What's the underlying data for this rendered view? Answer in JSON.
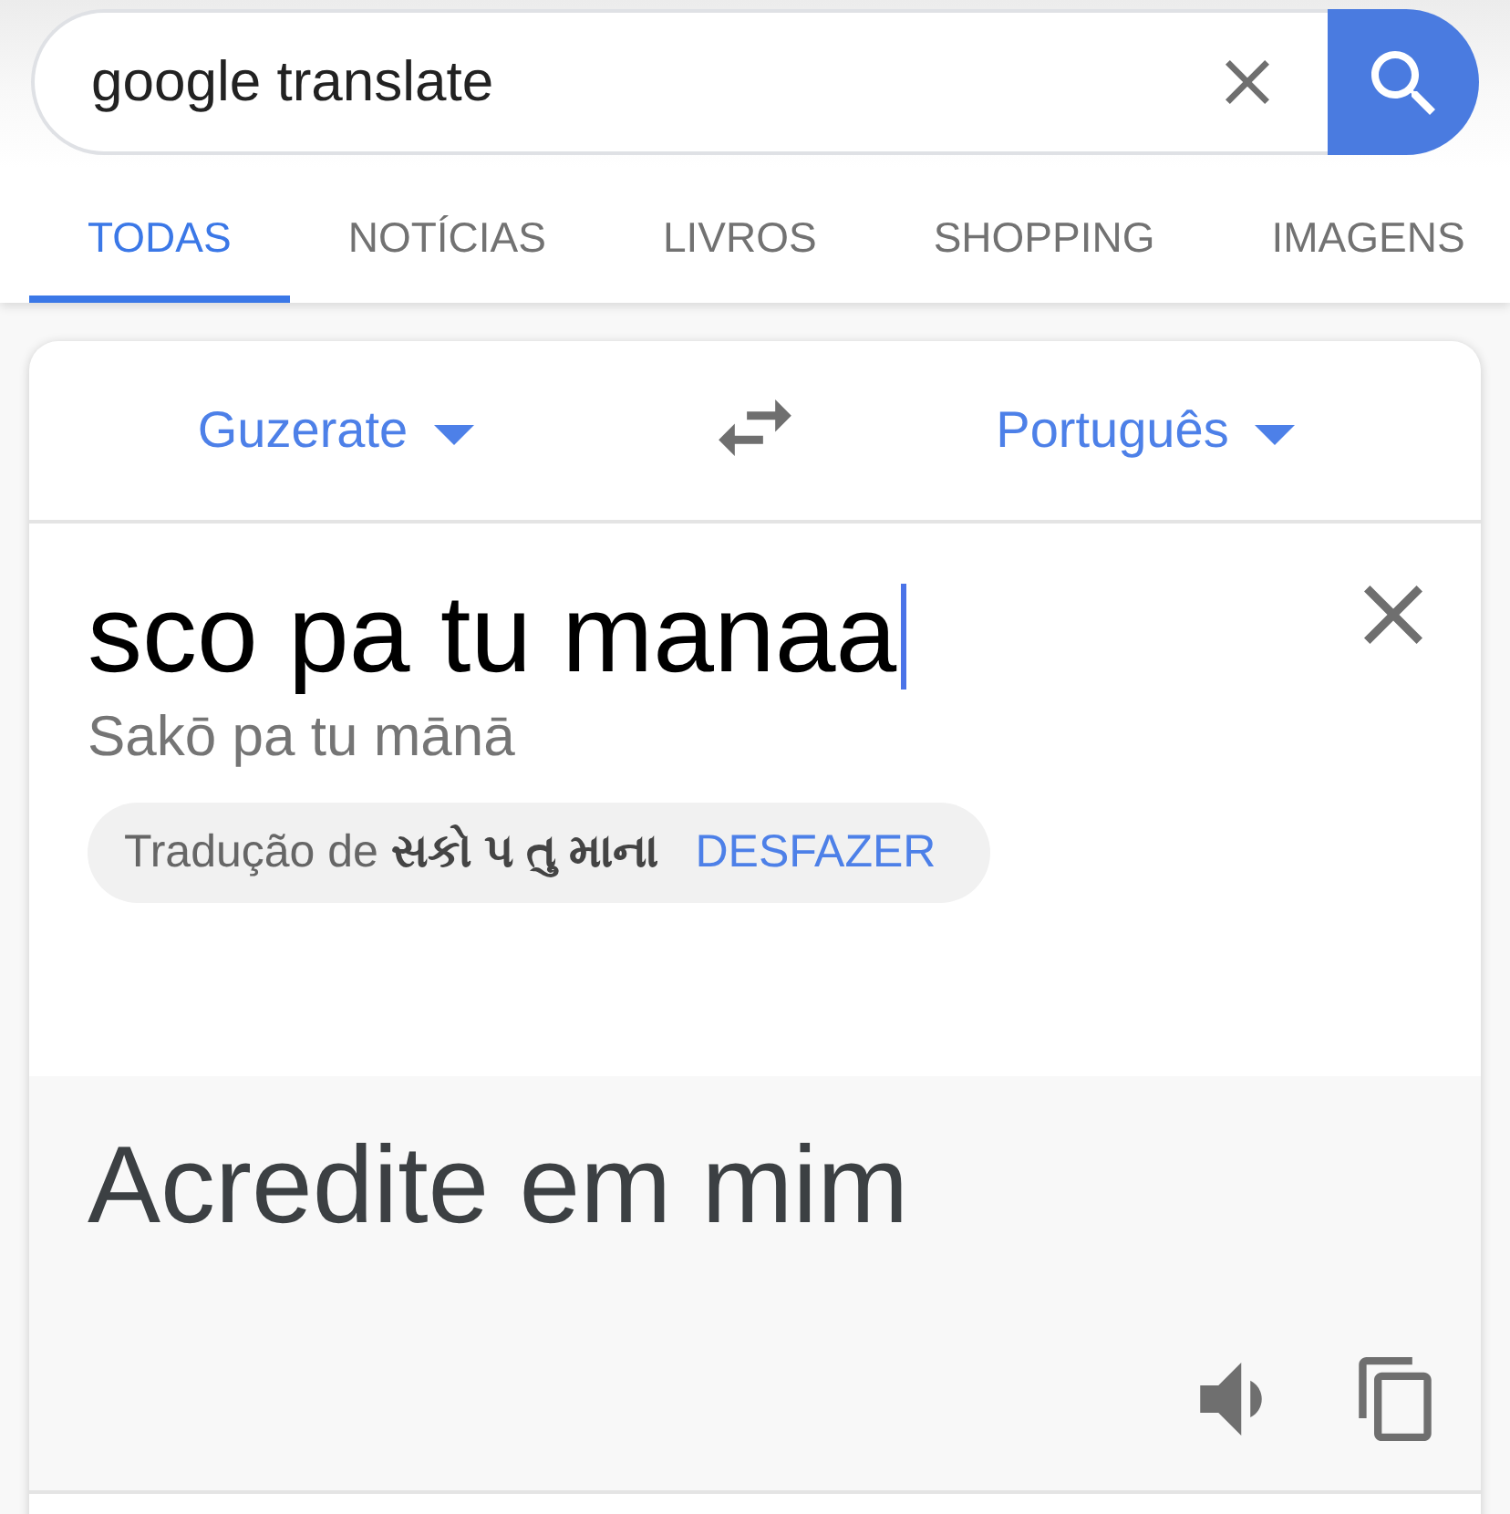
{
  "search": {
    "value": "google translate"
  },
  "tabs": [
    {
      "label": "TODAS",
      "selected": true
    },
    {
      "label": "NOTÍCIAS",
      "selected": false
    },
    {
      "label": "LIVROS",
      "selected": false
    },
    {
      "label": "SHOPPING",
      "selected": false
    },
    {
      "label": "IMAGENS",
      "selected": false
    }
  ],
  "translator": {
    "source_language": "Guzerate",
    "target_language": "Português",
    "input": {
      "value": "sco pa tu manaa",
      "focused": true,
      "transliteration": "Sakō pa tu mānā"
    },
    "suggestion": {
      "text": "Tradução de **સકો પ તુ માના**",
      "action": "DESFAZER"
    },
    "output": {
      "text": "Acredite em mim"
    }
  }
}
